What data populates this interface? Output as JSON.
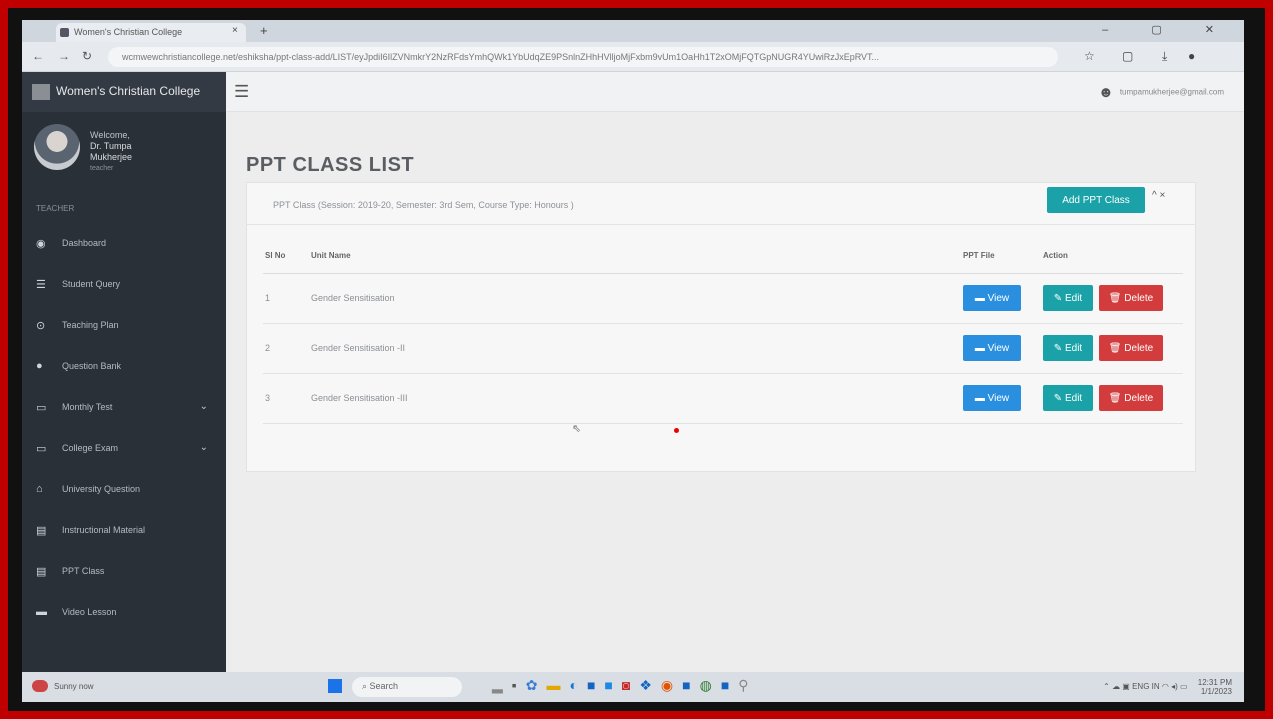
{
  "browser": {
    "tab_title": "Women's Christian College",
    "tab_close": "×",
    "new_tab": "+",
    "window_controls": "– ▢ ✕",
    "url": "wcmwewchristiancollege.net/eshiksha/ppt-class-add/LIST/eyJpdiI6IlZVNmkrY2NzRFdsYmhQWk1YbUdqZE9PSnlnZHhHVlljoMjFxbm9vUm1OaHh1T2xOMjFQTGpNUGR4YUwiRzJxEpRVT...",
    "back": "←",
    "forward": "→",
    "reload": "↻",
    "star": "☆",
    "download": "⤓"
  },
  "sidebar": {
    "brand": "Women's Christian College",
    "welcome": "Welcome,",
    "user_name_1": "Dr. Tumpa",
    "user_name_2": "Mukherjee",
    "user_role": "teacher",
    "section_label": "TEACHER",
    "items": [
      {
        "label": "Dashboard",
        "icon": "◉"
      },
      {
        "label": "Student Query",
        "icon": "☰"
      },
      {
        "label": "Teaching Plan",
        "icon": "⊙"
      },
      {
        "label": "Question Bank",
        "icon": "●"
      },
      {
        "label": "Monthly Test",
        "icon": "▭",
        "chevron": "⌄"
      },
      {
        "label": "College Exam",
        "icon": "▭",
        "chevron": "⌄"
      },
      {
        "label": "University Question",
        "icon": "⌂"
      },
      {
        "label": "Instructional Material",
        "icon": "▤"
      },
      {
        "label": "PPT Class",
        "icon": "▤"
      },
      {
        "label": "Video Lesson",
        "icon": "▬"
      }
    ]
  },
  "topbar": {
    "menu_icon": "☰",
    "user_email": "tumpamukherjee@gmail.com"
  },
  "main": {
    "page_title": "PPT CLASS LIST",
    "panel_subtitle": "PPT Class (Session: 2019-20, Semester: 3rd Sem, Course Type: Honours )",
    "add_button": "Add PPT Class",
    "panel_tools": "^ ×",
    "columns": {
      "sl": "Sl No",
      "unit": "Unit Name",
      "file": "PPT File",
      "action": "Action"
    },
    "view_label": "View",
    "edit_label": "Edit",
    "delete_label": "Delete",
    "rows": [
      {
        "sl": "1",
        "unit": "Gender Sensitisation"
      },
      {
        "sl": "2",
        "unit": "Gender Sensitisation -II"
      },
      {
        "sl": "3",
        "unit": "Gender Sensitisation -III"
      }
    ]
  },
  "taskbar": {
    "weather": "Sunny now",
    "search": "Search",
    "lang": "ENG IN",
    "time": "12:31 PM",
    "date": "1/1/2023"
  }
}
